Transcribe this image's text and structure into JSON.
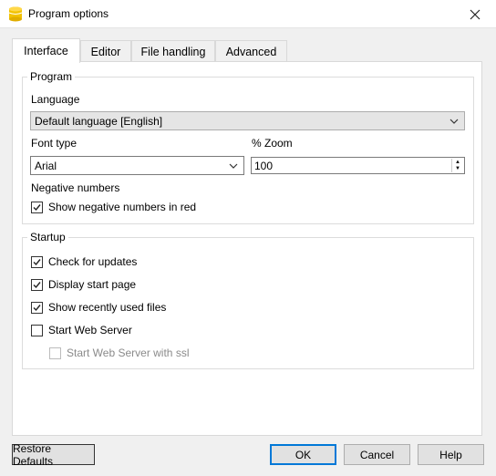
{
  "window": {
    "title": "Program options",
    "app_icon": "database-cylinder-icon",
    "close_icon": "close-icon"
  },
  "tabs": [
    {
      "label": "Interface",
      "active": true
    },
    {
      "label": "Editor",
      "active": false
    },
    {
      "label": "File handling",
      "active": false
    },
    {
      "label": "Advanced",
      "active": false
    }
  ],
  "program": {
    "legend": "Program",
    "language_label": "Language",
    "language_value": "Default language [English]",
    "font_type_label": "Font type",
    "font_type_value": "Arial",
    "zoom_label": "% Zoom",
    "zoom_value": "100",
    "negative_label": "Negative numbers",
    "show_negative_red": {
      "label": "Show negative numbers in red",
      "checked": true
    }
  },
  "startup": {
    "legend": "Startup",
    "options": [
      {
        "label": "Check for updates",
        "checked": true,
        "disabled": false
      },
      {
        "label": "Display start page",
        "checked": true,
        "disabled": false
      },
      {
        "label": "Show recently used files",
        "checked": true,
        "disabled": false
      },
      {
        "label": "Start Web Server",
        "checked": false,
        "disabled": false
      },
      {
        "label": "Start Web Server with ssl",
        "checked": false,
        "disabled": true
      }
    ]
  },
  "buttons": {
    "restore": "Restore Defaults",
    "ok": "OK",
    "cancel": "Cancel",
    "help": "Help"
  },
  "colors": {
    "accent": "#0078d7",
    "icon_yellow": "#f2c200"
  }
}
